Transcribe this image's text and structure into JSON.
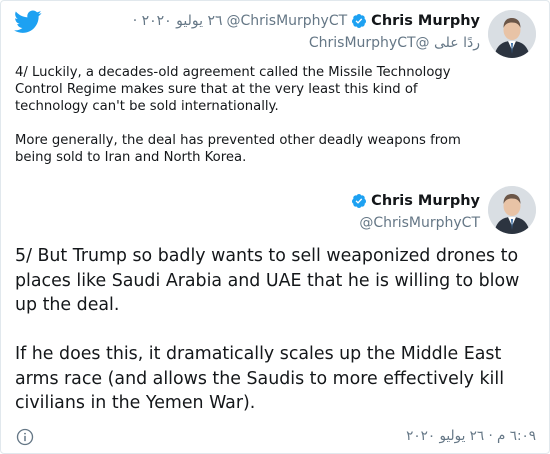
{
  "quoted_tweet": {
    "author_name": "Chris Murphy",
    "handle": "@ChrisMurphyCT",
    "date": "٢٦ يوليو ٢٠٢٠ ·",
    "reply_to": "ردًا على @ChrisMurphyCT",
    "paragraphs": [
      "4/ Luckily, a decades-old agreement called the Missile Technology Control Regime makes sure that at the very least this kind of technology can't be sold internationally.",
      "More generally, the deal has prevented other deadly weapons from being sold to Iran and North Korea."
    ]
  },
  "main_tweet": {
    "author_name": "Chris Murphy",
    "handle": "@ChrisMurphyCT",
    "paragraphs": [
      "5/ But Trump so badly wants to sell weaponized drones to places like Saudi Arabia and UAE that he is willing to blow up the deal.",
      "If he does this, it dramatically scales up the Middle East arms race (and allows the Saudis to more effectively kill civilians in the Yemen War)."
    ],
    "timestamp": "٦:٠٩ م · ٢٦ يوليو ٢٠٢٠"
  },
  "icons": {
    "logo": "twitter-bird-icon",
    "verified": "verified-badge-icon",
    "info": "info-icon"
  },
  "colors": {
    "twitter_blue": "#1da1f2",
    "secondary_text": "#657786",
    "primary_text": "#14171a"
  }
}
